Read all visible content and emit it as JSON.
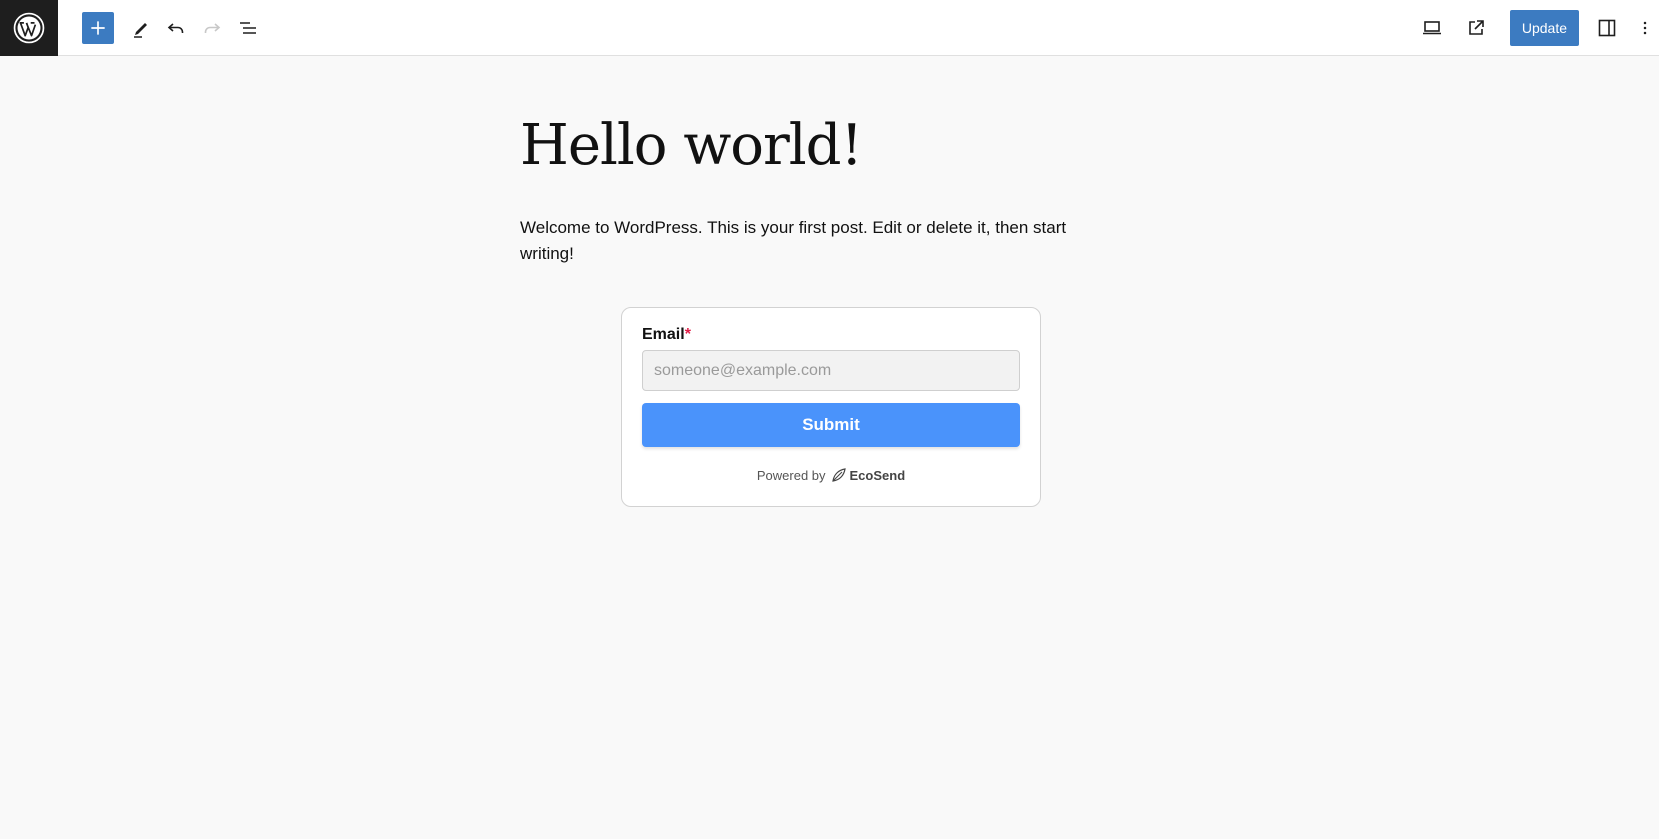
{
  "toolbar": {
    "logo_icon": "wordpress-logo-icon",
    "add_icon": "plus-icon",
    "tools_icon": "pencil-icon",
    "undo_icon": "undo-icon",
    "redo_icon": "redo-icon",
    "outline_icon": "list-view-icon",
    "preview_icon": "desktop-icon",
    "view_post_icon": "external-link-icon",
    "update_label": "Update",
    "settings_icon": "sidebar-toggle-icon",
    "options_icon": "more-vertical-icon",
    "accent_color": "#3c7bc1"
  },
  "post": {
    "title": "Hello world!",
    "body": "Welcome to WordPress. This is your first post. Edit or delete it, then start writing!"
  },
  "form": {
    "email_label": "Email",
    "required_mark": "*",
    "email_placeholder": "someone@example.com",
    "submit_label": "Submit",
    "powered_by": "Powered by",
    "brand_name": "EcoSend",
    "brand_icon": "leaf-icon",
    "submit_color": "#4a93fb"
  }
}
